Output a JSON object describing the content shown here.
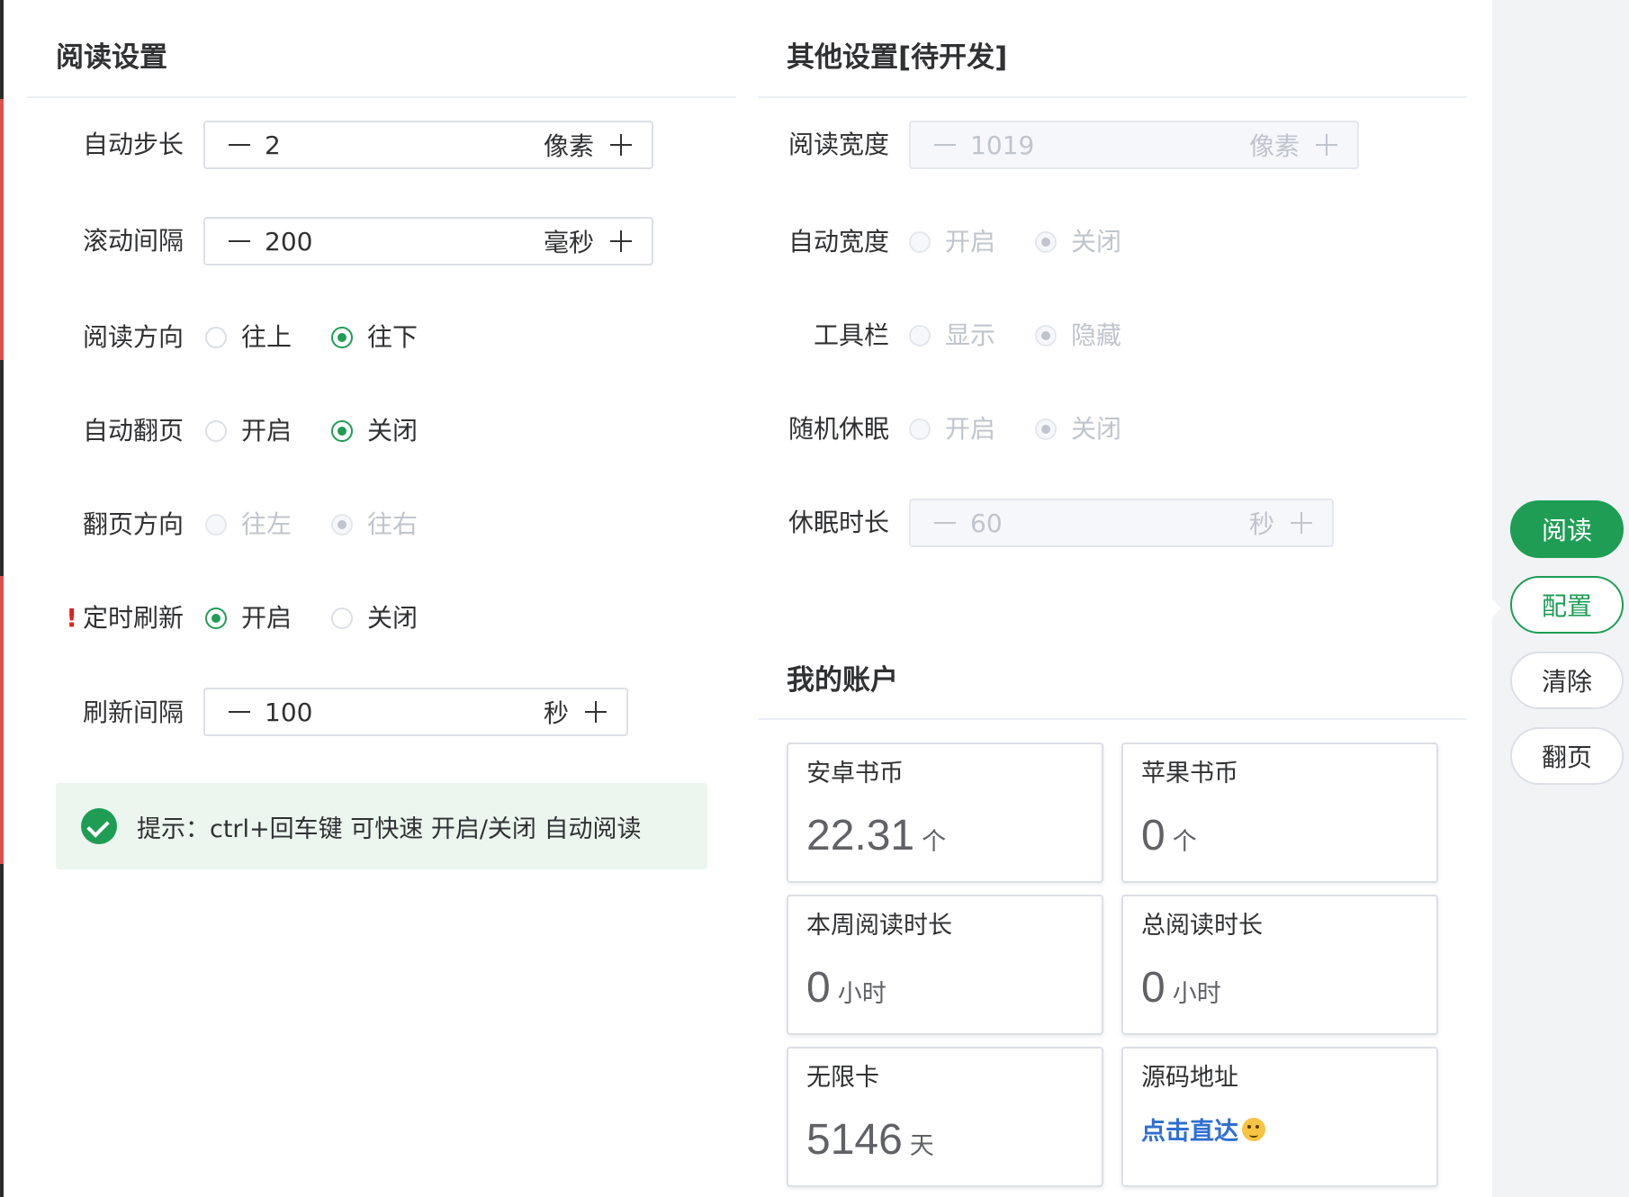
{
  "reading_settings": {
    "title": "阅读设置",
    "step": {
      "label": "自动步长",
      "value": "2",
      "unit": "像素"
    },
    "interval": {
      "label": "滚动间隔",
      "value": "200",
      "unit": "毫秒"
    },
    "direction": {
      "label": "阅读方向",
      "opt1": "往上",
      "opt2": "往下"
    },
    "auto_page": {
      "label": "自动翻页",
      "opt1": "开启",
      "opt2": "关闭"
    },
    "page_direction": {
      "label": "翻页方向",
      "opt1": "往左",
      "opt2": "往右"
    },
    "timed_refresh": {
      "mark": "!",
      "label": "定时刷新",
      "opt1": "开启",
      "opt2": "关闭"
    },
    "refresh_interval": {
      "label": "刷新间隔",
      "value": "100",
      "unit": "秒"
    },
    "tip": "提示：ctrl+回车键 可快速 开启/关闭 自动阅读"
  },
  "other_settings": {
    "title": "其他设置[待开发]",
    "read_width": {
      "label": "阅读宽度",
      "value": "1019",
      "unit": "像素"
    },
    "auto_width": {
      "label": "自动宽度",
      "opt1": "开启",
      "opt2": "关闭"
    },
    "toolbar": {
      "label": "工具栏",
      "opt1": "显示",
      "opt2": "隐藏"
    },
    "random_sleep": {
      "label": "随机休眠",
      "opt1": "开启",
      "opt2": "关闭"
    },
    "sleep_duration": {
      "label": "休眠时长",
      "value": "60",
      "unit": "秒"
    }
  },
  "account": {
    "title": "我的账户",
    "android_coins": {
      "label": "安卓书币",
      "value": "22.31",
      "unit": "个"
    },
    "apple_coins": {
      "label": "苹果书币",
      "value": "0",
      "unit": "个"
    },
    "week_time": {
      "label": "本周阅读时长",
      "value": "0",
      "unit": "小时"
    },
    "total_time": {
      "label": "总阅读时长",
      "value": "0",
      "unit": "小时"
    },
    "unlimited_card": {
      "label": "无限卡",
      "value": "5146",
      "unit": "天"
    },
    "source": {
      "label": "源码地址",
      "link": "点击直达"
    }
  },
  "side_buttons": {
    "read": "阅读",
    "config": "配置",
    "clear": "清除",
    "page": "翻页"
  },
  "colors": {
    "accent": "#1f9d55",
    "link": "#2f6fd0",
    "disabled": "#c0c4cc"
  },
  "icons": {
    "tip": "check-circle-icon",
    "source_link": "emoji-icon"
  }
}
